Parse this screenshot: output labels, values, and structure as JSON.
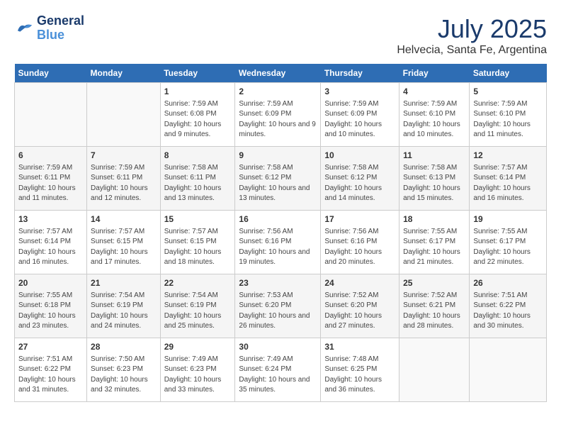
{
  "header": {
    "logo": {
      "general": "General",
      "blue": "Blue"
    },
    "title": "July 2025",
    "location": "Helvecia, Santa Fe, Argentina"
  },
  "calendar": {
    "headers": [
      "Sunday",
      "Monday",
      "Tuesday",
      "Wednesday",
      "Thursday",
      "Friday",
      "Saturday"
    ],
    "weeks": [
      [
        {
          "day": "",
          "info": ""
        },
        {
          "day": "",
          "info": ""
        },
        {
          "day": "1",
          "info": "Sunrise: 7:59 AM\nSunset: 6:08 PM\nDaylight: 10 hours and 9 minutes."
        },
        {
          "day": "2",
          "info": "Sunrise: 7:59 AM\nSunset: 6:09 PM\nDaylight: 10 hours and 9 minutes."
        },
        {
          "day": "3",
          "info": "Sunrise: 7:59 AM\nSunset: 6:09 PM\nDaylight: 10 hours and 10 minutes."
        },
        {
          "day": "4",
          "info": "Sunrise: 7:59 AM\nSunset: 6:10 PM\nDaylight: 10 hours and 10 minutes."
        },
        {
          "day": "5",
          "info": "Sunrise: 7:59 AM\nSunset: 6:10 PM\nDaylight: 10 hours and 11 minutes."
        }
      ],
      [
        {
          "day": "6",
          "info": "Sunrise: 7:59 AM\nSunset: 6:11 PM\nDaylight: 10 hours and 11 minutes."
        },
        {
          "day": "7",
          "info": "Sunrise: 7:59 AM\nSunset: 6:11 PM\nDaylight: 10 hours and 12 minutes."
        },
        {
          "day": "8",
          "info": "Sunrise: 7:58 AM\nSunset: 6:11 PM\nDaylight: 10 hours and 13 minutes."
        },
        {
          "day": "9",
          "info": "Sunrise: 7:58 AM\nSunset: 6:12 PM\nDaylight: 10 hours and 13 minutes."
        },
        {
          "day": "10",
          "info": "Sunrise: 7:58 AM\nSunset: 6:12 PM\nDaylight: 10 hours and 14 minutes."
        },
        {
          "day": "11",
          "info": "Sunrise: 7:58 AM\nSunset: 6:13 PM\nDaylight: 10 hours and 15 minutes."
        },
        {
          "day": "12",
          "info": "Sunrise: 7:57 AM\nSunset: 6:14 PM\nDaylight: 10 hours and 16 minutes."
        }
      ],
      [
        {
          "day": "13",
          "info": "Sunrise: 7:57 AM\nSunset: 6:14 PM\nDaylight: 10 hours and 16 minutes."
        },
        {
          "day": "14",
          "info": "Sunrise: 7:57 AM\nSunset: 6:15 PM\nDaylight: 10 hours and 17 minutes."
        },
        {
          "day": "15",
          "info": "Sunrise: 7:57 AM\nSunset: 6:15 PM\nDaylight: 10 hours and 18 minutes."
        },
        {
          "day": "16",
          "info": "Sunrise: 7:56 AM\nSunset: 6:16 PM\nDaylight: 10 hours and 19 minutes."
        },
        {
          "day": "17",
          "info": "Sunrise: 7:56 AM\nSunset: 6:16 PM\nDaylight: 10 hours and 20 minutes."
        },
        {
          "day": "18",
          "info": "Sunrise: 7:55 AM\nSunset: 6:17 PM\nDaylight: 10 hours and 21 minutes."
        },
        {
          "day": "19",
          "info": "Sunrise: 7:55 AM\nSunset: 6:17 PM\nDaylight: 10 hours and 22 minutes."
        }
      ],
      [
        {
          "day": "20",
          "info": "Sunrise: 7:55 AM\nSunset: 6:18 PM\nDaylight: 10 hours and 23 minutes."
        },
        {
          "day": "21",
          "info": "Sunrise: 7:54 AM\nSunset: 6:19 PM\nDaylight: 10 hours and 24 minutes."
        },
        {
          "day": "22",
          "info": "Sunrise: 7:54 AM\nSunset: 6:19 PM\nDaylight: 10 hours and 25 minutes."
        },
        {
          "day": "23",
          "info": "Sunrise: 7:53 AM\nSunset: 6:20 PM\nDaylight: 10 hours and 26 minutes."
        },
        {
          "day": "24",
          "info": "Sunrise: 7:52 AM\nSunset: 6:20 PM\nDaylight: 10 hours and 27 minutes."
        },
        {
          "day": "25",
          "info": "Sunrise: 7:52 AM\nSunset: 6:21 PM\nDaylight: 10 hours and 28 minutes."
        },
        {
          "day": "26",
          "info": "Sunrise: 7:51 AM\nSunset: 6:22 PM\nDaylight: 10 hours and 30 minutes."
        }
      ],
      [
        {
          "day": "27",
          "info": "Sunrise: 7:51 AM\nSunset: 6:22 PM\nDaylight: 10 hours and 31 minutes."
        },
        {
          "day": "28",
          "info": "Sunrise: 7:50 AM\nSunset: 6:23 PM\nDaylight: 10 hours and 32 minutes."
        },
        {
          "day": "29",
          "info": "Sunrise: 7:49 AM\nSunset: 6:23 PM\nDaylight: 10 hours and 33 minutes."
        },
        {
          "day": "30",
          "info": "Sunrise: 7:49 AM\nSunset: 6:24 PM\nDaylight: 10 hours and 35 minutes."
        },
        {
          "day": "31",
          "info": "Sunrise: 7:48 AM\nSunset: 6:25 PM\nDaylight: 10 hours and 36 minutes."
        },
        {
          "day": "",
          "info": ""
        },
        {
          "day": "",
          "info": ""
        }
      ]
    ]
  }
}
